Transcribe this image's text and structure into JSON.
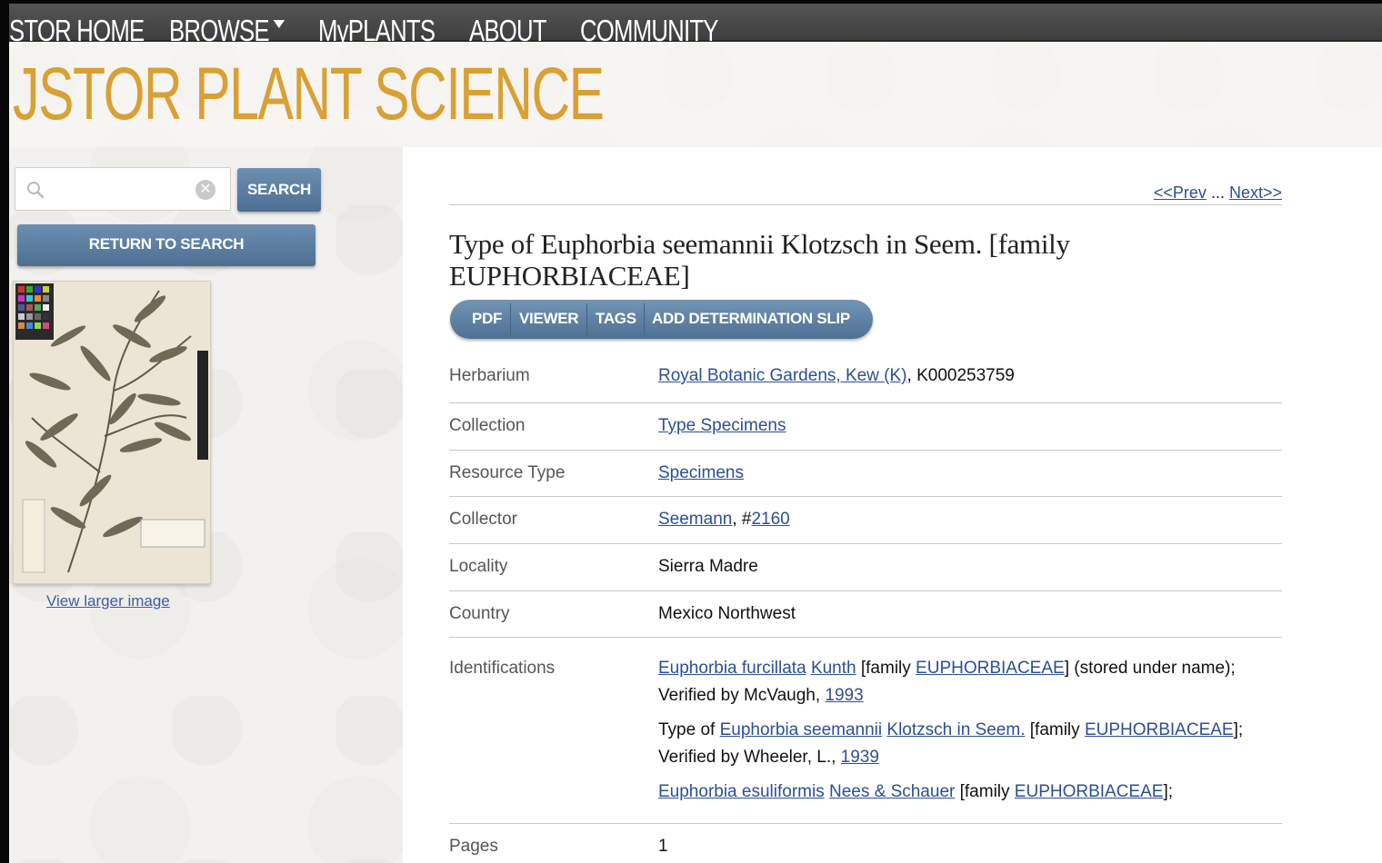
{
  "nav": {
    "home": "STOR HOME",
    "browse": "BROWSE",
    "myplants": "MyPLANTS",
    "about": "ABOUT",
    "community": "COMMUNITY"
  },
  "site_title": "JSTOR PLANT SCIENCE",
  "sidebar": {
    "search_placeholder": "",
    "search_button": "SEARCH",
    "return_button": "RETURN TO SEARCH",
    "view_larger": "View larger image"
  },
  "pager": {
    "prev": "<<Prev",
    "sep": " ... ",
    "next": "Next>>"
  },
  "record": {
    "title_line1": "Type of Euphorbia seemannii Klotzsch in Seem. [family",
    "title_line2": "EUPHORBIACEAE]"
  },
  "actions": {
    "pdf": "PDF",
    "viewer": "VIEWER",
    "tags": "TAGS",
    "add_slip": "ADD DETERMINATION SLIP"
  },
  "fields": {
    "herbarium": {
      "label": "Herbarium",
      "link": "Royal Botanic Gardens, Kew (K)",
      "rest": ", K000253759"
    },
    "collection": {
      "label": "Collection",
      "link": "Type Specimens"
    },
    "resource_type": {
      "label": "Resource Type",
      "link": "Specimens"
    },
    "collector": {
      "label": "Collector",
      "link": "Seemann",
      "mid": ", #",
      "number": "2160"
    },
    "locality": {
      "label": "Locality",
      "value": "Sierra Madre"
    },
    "country": {
      "label": "Country",
      "value": "Mexico Northwest"
    },
    "identifications": {
      "label": "Identifications",
      "id1": {
        "name": "Euphorbia furcillata",
        "author": "Kunth",
        "fam_pre": " [family ",
        "family": "EUPHORBIACEAE",
        "tail": "] (stored under name);",
        "verified": "Verified by McVaugh, ",
        "year": "1993"
      },
      "id2": {
        "prefix": "Type of ",
        "name": "Euphorbia seemannii",
        "author": "Klotzsch in Seem.",
        "fam_pre": " [family ",
        "family": "EUPHORBIACEAE",
        "tail": "];",
        "verified": "Verified by Wheeler, L., ",
        "year": "1939"
      },
      "id3": {
        "name": "Euphorbia esuliformis",
        "author": "Nees & Schauer",
        "fam_pre": " [family ",
        "family": "EUPHORBIACEAE",
        "tail": "];"
      }
    },
    "pages": {
      "label": "Pages",
      "value": "1"
    }
  }
}
